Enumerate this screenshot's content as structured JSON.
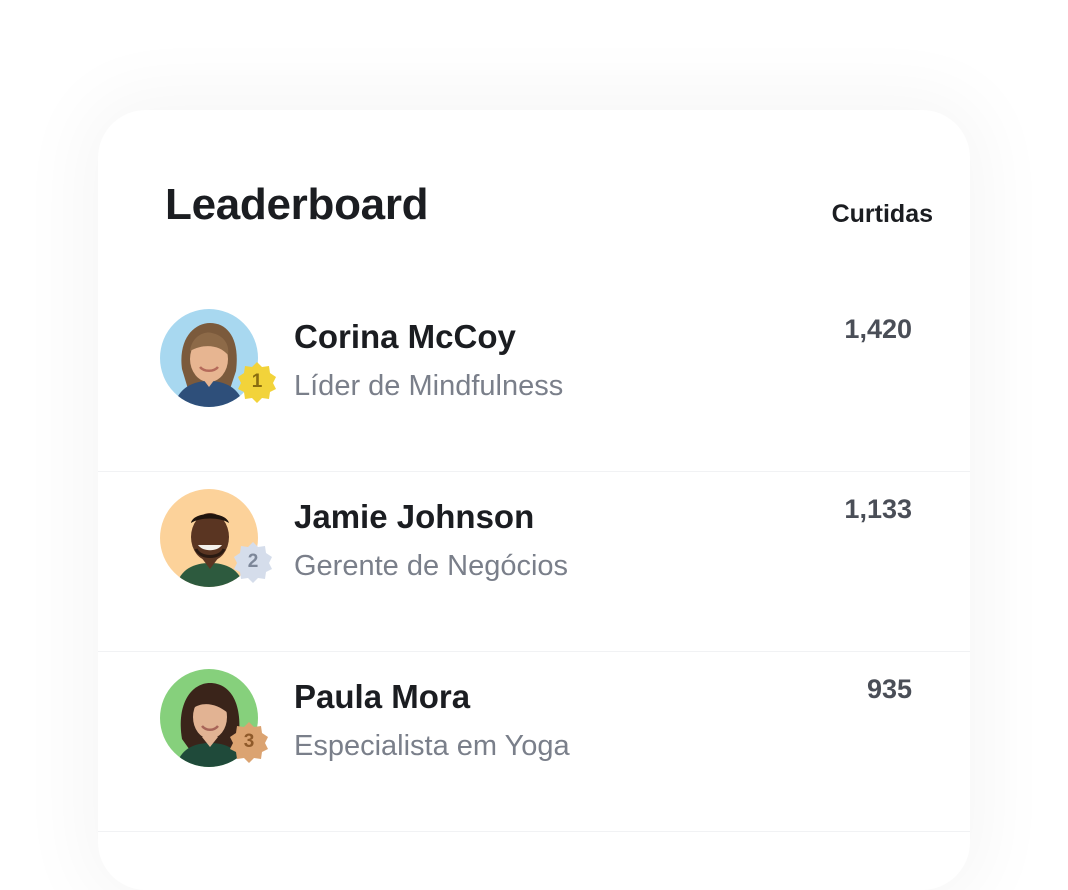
{
  "leaderboard": {
    "title": "Leaderboard",
    "column_label": "Curtidas",
    "entries": [
      {
        "rank": "1",
        "name": "Corina McCoy",
        "role": "Líder de Mindfulness",
        "likes": "1,420",
        "avatar_bg": "#a8d8f0",
        "badge_color": "#f2d33a",
        "badge_text_color": "#8a6d10"
      },
      {
        "rank": "2",
        "name": "Jamie Johnson",
        "role": "Gerente de Negócios",
        "likes": "1,133",
        "avatar_bg": "#fcd29a",
        "badge_color": "#d5ddeb",
        "badge_text_color": "#7d8799"
      },
      {
        "rank": "3",
        "name": "Paula Mora",
        "role": "Especialista em Yoga",
        "likes": "935",
        "avatar_bg": "#86d07c",
        "badge_color": "#dba371",
        "badge_text_color": "#8f5a2a"
      }
    ]
  }
}
